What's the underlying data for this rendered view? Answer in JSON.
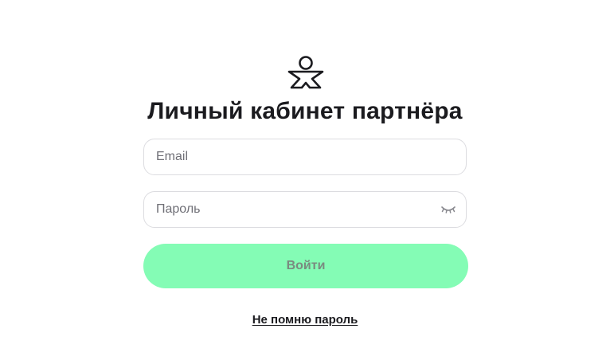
{
  "header": {
    "logo_icon": "person-logo-icon",
    "title": "Личный кабинет партнёра"
  },
  "form": {
    "email": {
      "placeholder": "Email",
      "value": ""
    },
    "password": {
      "placeholder": "Пароль",
      "value": "",
      "toggle_icon": "eye-closed-icon"
    },
    "submit_label": "Войти",
    "forgot_label": "Не помню пароль"
  },
  "colors": {
    "accent": "#84fcb5",
    "text": "#1b1b1f",
    "border": "#dcdce0"
  }
}
